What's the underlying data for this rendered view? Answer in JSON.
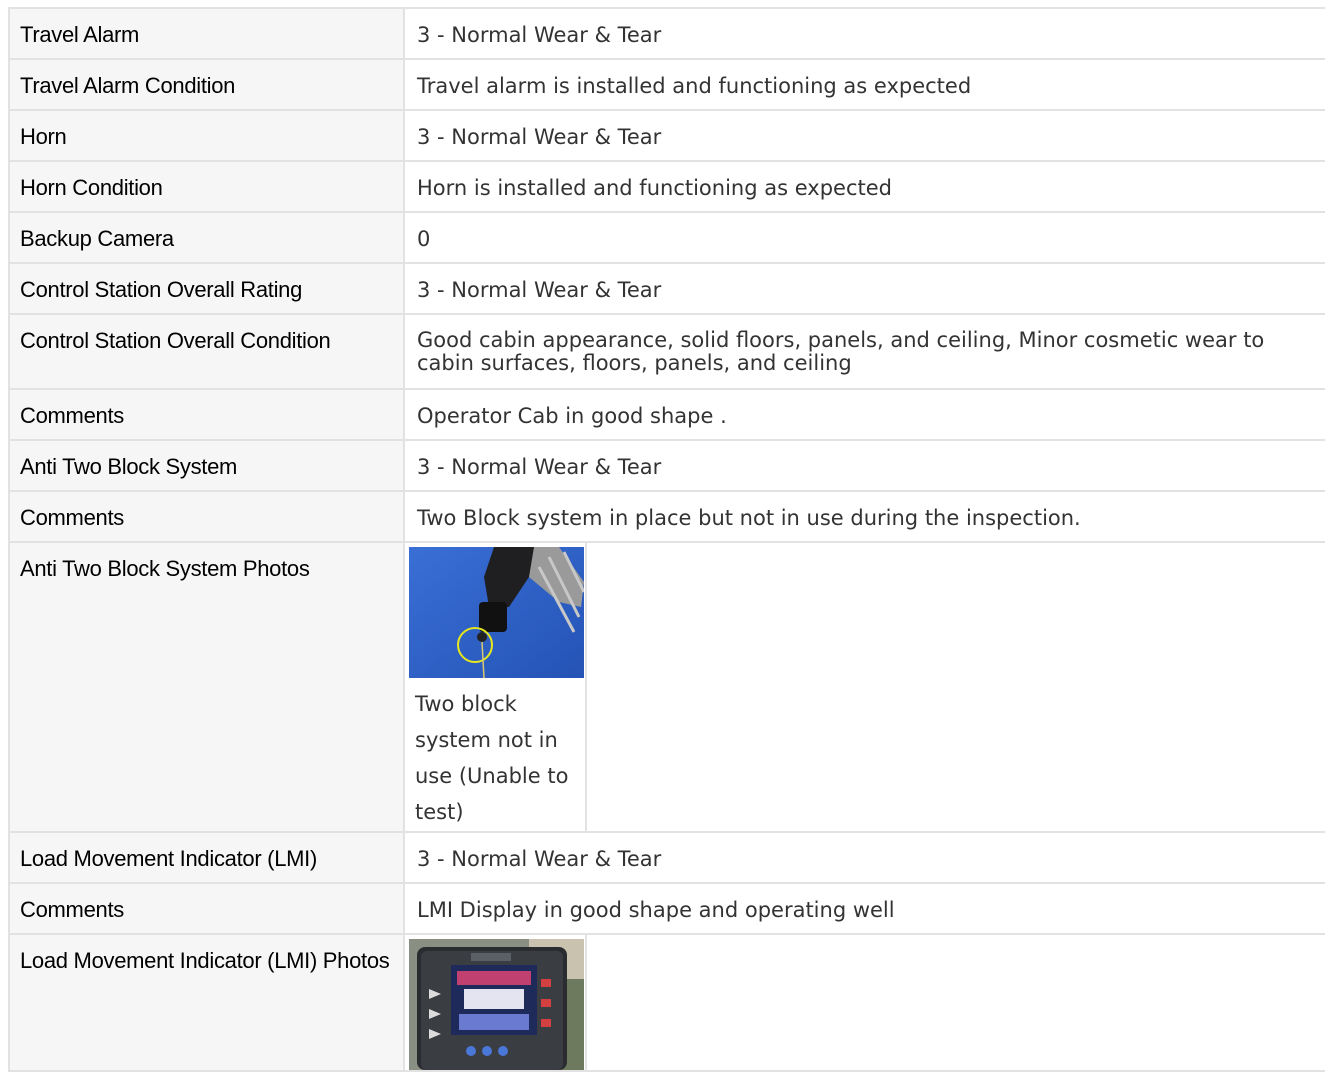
{
  "rows": [
    {
      "label": "Travel Alarm",
      "value": "3 - Normal Wear & Tear"
    },
    {
      "label": "Travel Alarm Condition",
      "value": "Travel alarm is installed and functioning as expected"
    },
    {
      "label": "Horn",
      "value": "3 - Normal Wear & Tear"
    },
    {
      "label": "Horn Condition",
      "value": "Horn is installed and functioning as expected"
    },
    {
      "label": "Backup Camera",
      "value": "0"
    },
    {
      "label": "Control Station Overall Rating",
      "value": "3 - Normal Wear & Tear"
    },
    {
      "label": "Control Station Overall Condition",
      "value": "Good cabin appearance, solid floors, panels, and ceiling, Minor cosmetic wear to cabin surfaces, floors, panels, and ceiling"
    },
    {
      "label": "Comments",
      "value": "Operator Cab in good shape ."
    },
    {
      "label": "Anti Two Block System",
      "value": "3 - Normal Wear & Tear"
    },
    {
      "label": "Comments",
      "value": "Two Block system in place but not in use during the inspection."
    },
    {
      "label": "Anti Two Block System Photos",
      "photo_caption": "Two block system not in use (Unable to test)"
    },
    {
      "label": "Load Movement Indicator (LMI)",
      "value": "3 - Normal Wear & Tear"
    },
    {
      "label": "Comments",
      "value": "LMI Display in good shape and operating well"
    },
    {
      "label": "Load Movement Indicator (LMI) Photos"
    }
  ],
  "colors": {
    "label_bg": "#f6f6f6",
    "border": "#e2e2e2",
    "value_text": "#333333",
    "photo_sky": "#2f5fc4",
    "photo_highlight": "#e6e61e"
  }
}
